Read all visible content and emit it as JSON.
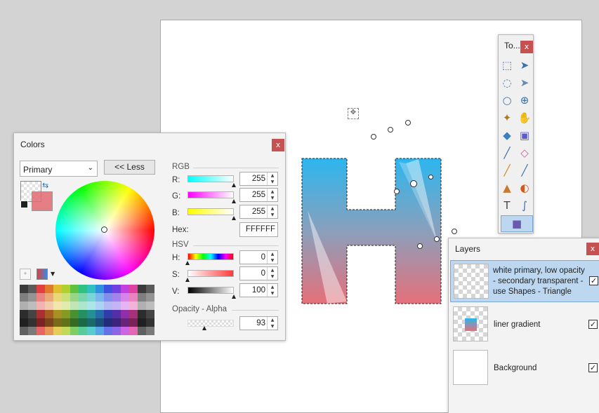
{
  "tools_window": {
    "title": "To...",
    "close": "x",
    "tools": [
      {
        "name": "rectangle-select-tool",
        "glyph": "⬚",
        "color": "#4a6fa5"
      },
      {
        "name": "move-selected-pixels-tool",
        "glyph": "➤",
        "color": "#3a6fb0"
      },
      {
        "name": "lasso-select-tool",
        "glyph": "◌",
        "color": "#4a6fa5"
      },
      {
        "name": "move-selection-tool",
        "glyph": "➤",
        "color": "#6a8bb5"
      },
      {
        "name": "ellipse-select-tool",
        "glyph": "○",
        "color": "#4a6fa5"
      },
      {
        "name": "zoom-tool",
        "glyph": "⊕",
        "color": "#2f6fb0"
      },
      {
        "name": "magic-wand-tool",
        "glyph": "✦",
        "color": "#b07a20"
      },
      {
        "name": "pan-tool",
        "glyph": "✋",
        "color": "#c98a2b"
      },
      {
        "name": "paint-bucket-tool",
        "glyph": "◆",
        "color": "#3a7fc0"
      },
      {
        "name": "gradient-tool",
        "glyph": "▣",
        "color": "#5a5ad0"
      },
      {
        "name": "paintbrush-tool",
        "glyph": "╱",
        "color": "#3a6fb0"
      },
      {
        "name": "eraser-tool",
        "glyph": "◇",
        "color": "#d060a0"
      },
      {
        "name": "pencil-tool",
        "glyph": "╱",
        "color": "#d08a20"
      },
      {
        "name": "color-picker-tool",
        "glyph": "╱",
        "color": "#3a6fb0"
      },
      {
        "name": "clone-stamp-tool",
        "glyph": "▲",
        "color": "#c87a30"
      },
      {
        "name": "recolor-tool",
        "glyph": "◐",
        "color": "#d05a20"
      },
      {
        "name": "text-tool",
        "glyph": "T",
        "color": "#444"
      },
      {
        "name": "line-curve-tool",
        "glyph": "∫",
        "color": "#3a6fb0"
      },
      {
        "name": "shapes-tool",
        "glyph": "■",
        "color": "#6a5ab0"
      }
    ]
  },
  "colors_window": {
    "title": "Colors",
    "close": "x",
    "mode_select": "Primary",
    "less_button": "<< Less",
    "rgb_label": "RGB",
    "r_label": "R:",
    "r_value": "255",
    "g_label": "G:",
    "g_value": "255",
    "b_label": "B:",
    "b_value": "255",
    "hex_label": "Hex:",
    "hex_value": "FFFFFF",
    "hsv_label": "HSV",
    "h_label": "H:",
    "h_value": "0",
    "s_label": "S:",
    "s_value": "0",
    "v_label": "V:",
    "v_value": "100",
    "opacity_label": "Opacity - Alpha",
    "opacity_value": "93",
    "primary_color": "#ffffff",
    "secondary_color": "#e46a74"
  },
  "layers_window": {
    "title": "Layers",
    "close": "x",
    "layers": [
      {
        "name": "white primary, low opacity - secondary transparent - use Shapes - Triangle",
        "visible": true,
        "selected": true
      },
      {
        "name": "liner gradient",
        "visible": true,
        "selected": false
      },
      {
        "name": "Background",
        "visible": true,
        "selected": false
      }
    ]
  },
  "palette": [
    "#3a3a3a",
    "#5a5a5a",
    "#e04040",
    "#e07a30",
    "#e0c030",
    "#b0d030",
    "#60c040",
    "#30c080",
    "#30c0c0",
    "#3090e0",
    "#4050e0",
    "#7040e0",
    "#c040e0",
    "#e040a0"
  ],
  "check_mark": "✓"
}
